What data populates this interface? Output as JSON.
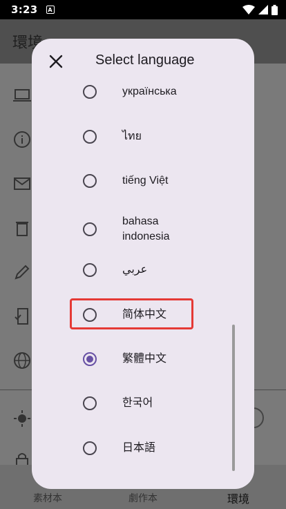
{
  "status_bar": {
    "time": "3:23",
    "notification_letter": "A"
  },
  "background": {
    "title": "環境",
    "nav": [
      {
        "label": "素材本"
      },
      {
        "label": "劇作本"
      },
      {
        "label": "環境"
      }
    ]
  },
  "dialog": {
    "title": "Select language",
    "close_icon": "close-icon",
    "options": [
      {
        "label": "українська",
        "selected": false
      },
      {
        "label": "ไทย",
        "selected": false
      },
      {
        "label": "tiếng Việt",
        "selected": false
      },
      {
        "label": "bahasa indonesia",
        "selected": false
      },
      {
        "label": "عربي",
        "selected": false
      },
      {
        "label": "简体中文",
        "selected": false
      },
      {
        "label": "繁體中文",
        "selected": true
      },
      {
        "label": "한국어",
        "selected": false
      },
      {
        "label": "日本語",
        "selected": false
      }
    ]
  },
  "colors": {
    "accent": "#6750a4",
    "highlight": "#e53935",
    "dialog_bg": "#ece6f0"
  }
}
